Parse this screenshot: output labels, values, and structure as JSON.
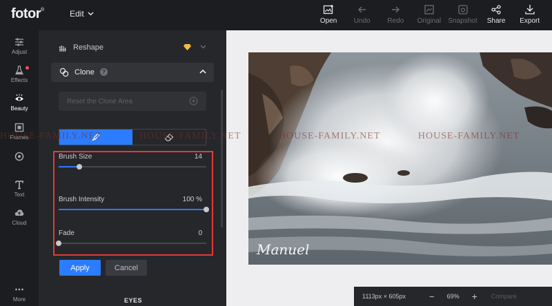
{
  "app": {
    "logo": "fotor",
    "logo_mark": "®",
    "edit_label": "Edit"
  },
  "toolbar": [
    {
      "label": "Open",
      "icon": "open-image-icon",
      "enabled": true
    },
    {
      "label": "Undo",
      "icon": "undo-arrow-icon",
      "enabled": false
    },
    {
      "label": "Redo",
      "icon": "redo-arrow-icon",
      "enabled": false
    },
    {
      "label": "Original",
      "icon": "original-image-icon",
      "enabled": false
    },
    {
      "label": "Snapshot",
      "icon": "snapshot-icon",
      "enabled": false
    },
    {
      "label": "Share",
      "icon": "share-icon",
      "enabled": true
    },
    {
      "label": "Export",
      "icon": "download-icon",
      "enabled": true
    }
  ],
  "sidebar": [
    {
      "label": "Adjust",
      "icon": "sliders-icon"
    },
    {
      "label": "Effects",
      "icon": "flask-icon"
    },
    {
      "label": "Beauty",
      "icon": "eye-icon"
    },
    {
      "label": "Frames",
      "icon": "frame-icon"
    },
    {
      "label": "Sticker",
      "icon": "sticker-icon"
    },
    {
      "label": "Text",
      "icon": "text-icon"
    },
    {
      "label": "Cloud",
      "icon": "cloud-upload-icon"
    },
    {
      "label": "More",
      "icon": "more-dots-icon"
    }
  ],
  "panel": {
    "reshape_label": "Reshape",
    "clone_label": "Clone",
    "reset_label": "Reset the Clone Area",
    "brush_size": {
      "label": "Brush Size",
      "value": "14",
      "level": 0.14
    },
    "brush_intensity": {
      "label": "Brush Intensity",
      "value": "100 %",
      "level": 1.0
    },
    "fade": {
      "label": "Fade",
      "value": "0",
      "level": 0.0
    },
    "apply_label": "Apply",
    "cancel_label": "Cancel",
    "next_section": "EYES"
  },
  "canvas": {
    "signature": "Manuel",
    "watermark": "HOUSE-FAMILY.NET"
  },
  "status": {
    "dimensions": "1113px × 605px",
    "zoom": "69%",
    "compare_label": "Compare"
  },
  "colors": {
    "accent": "#2b7cff",
    "highlight": "#e53a3a",
    "notification": "#ff4d5a",
    "premium": "#f6c343"
  }
}
